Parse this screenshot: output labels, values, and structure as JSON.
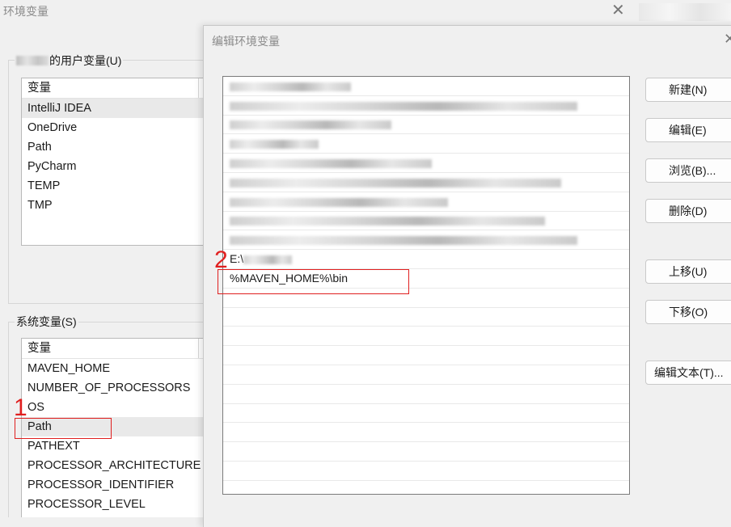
{
  "background_window": {
    "title": "环境变量",
    "user_group_label_suffix": "的用户变量(U)",
    "user_vars": {
      "header": "变量",
      "items": [
        "IntelliJ IDEA",
        "OneDrive",
        "Path",
        "PyCharm",
        "TEMP",
        "TMP"
      ]
    },
    "system_group_label": "系统变量(S)",
    "system_vars": {
      "header": "变量",
      "items": [
        "MAVEN_HOME",
        "NUMBER_OF_PROCESSORS",
        "OS",
        "Path",
        "PATHEXT",
        "PROCESSOR_ARCHITECTURE",
        "PROCESSOR_IDENTIFIER",
        "PROCESSOR_LEVEL"
      ]
    },
    "close_glyph": "✕"
  },
  "edit_dialog": {
    "title": "编辑环境变量",
    "close_glyph": "✕",
    "path_entries": {
      "partial_entry": "E:\\",
      "new_entry": "%MAVEN_HOME%\\bin"
    },
    "buttons": {
      "new": "新建(N)",
      "edit": "编辑(E)",
      "browse": "浏览(B)...",
      "delete": "删除(D)",
      "move_up": "上移(U)",
      "move_down": "下移(O)",
      "edit_text": "编辑文本(T)..."
    }
  },
  "annotations": {
    "step1": "1",
    "step2": "2",
    "color": "#e01f1f"
  }
}
